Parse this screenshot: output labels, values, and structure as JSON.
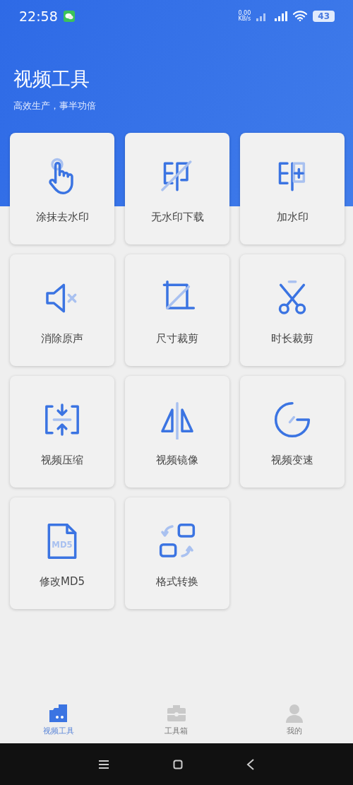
{
  "status_bar": {
    "time": "22:58",
    "net_speed": [
      "0.00",
      "KB/s"
    ],
    "battery": "43"
  },
  "header": {
    "title": "视频工具",
    "subtitle": "高效生产，事半功倍"
  },
  "tools": [
    {
      "kind": "smudge",
      "label": "涂抹去水印"
    },
    {
      "kind": "no_watermark",
      "label": "无水印下载"
    },
    {
      "kind": "add_watermark",
      "label": "加水印"
    },
    {
      "kind": "mute",
      "label": "消除原声"
    },
    {
      "kind": "crop",
      "label": "尺寸裁剪"
    },
    {
      "kind": "trim",
      "label": "时长裁剪"
    },
    {
      "kind": "compress",
      "label": "视频压缩"
    },
    {
      "kind": "mirror",
      "label": "视频镜像"
    },
    {
      "kind": "speed",
      "label": "视频变速"
    },
    {
      "kind": "md5",
      "label": "修改MD5",
      "icon_text": "MD5"
    },
    {
      "kind": "convert",
      "label": "格式转换"
    }
  ],
  "tabs": [
    {
      "kind": "camera",
      "label": "视频工具",
      "selected": true
    },
    {
      "kind": "toolbox",
      "label": "工具箱",
      "selected": false
    },
    {
      "kind": "profile",
      "label": "我的",
      "selected": false
    }
  ]
}
